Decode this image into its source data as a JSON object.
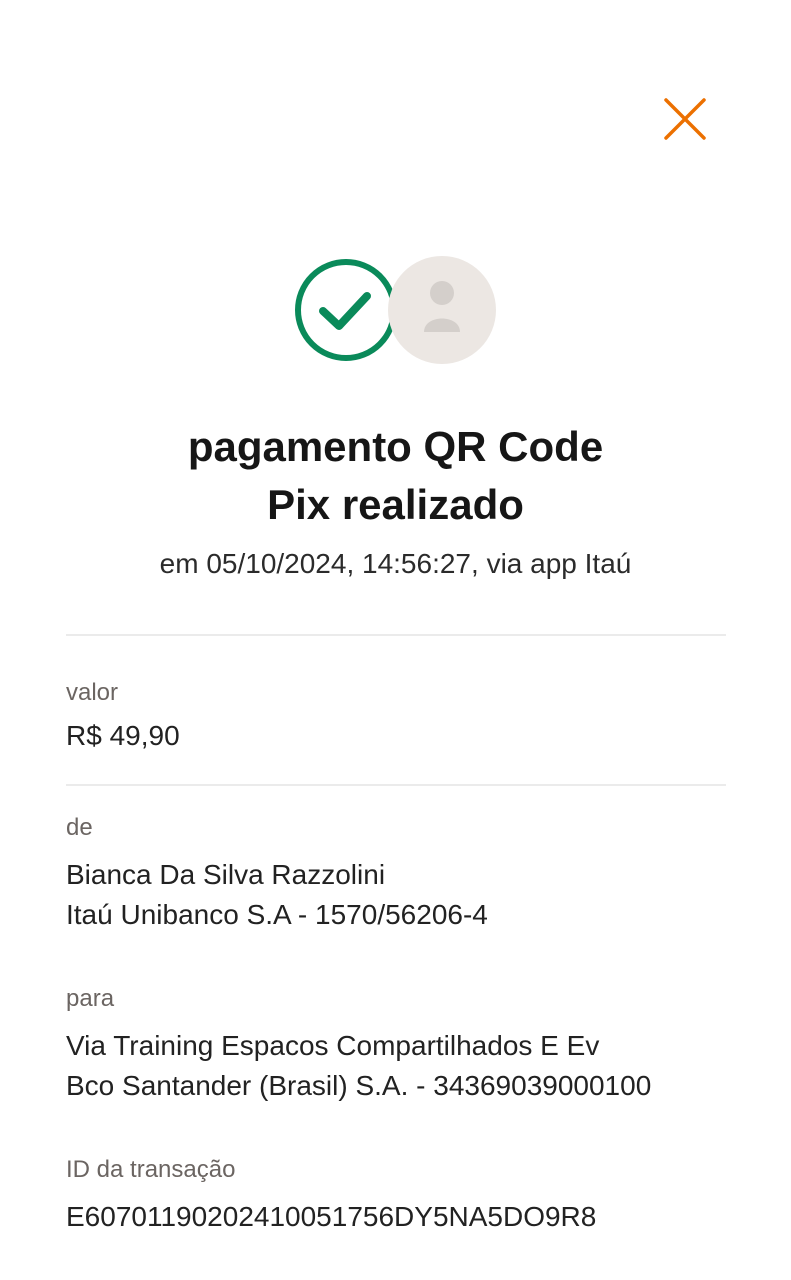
{
  "close": {
    "icon": "close-icon",
    "color": "#ec7000"
  },
  "status": {
    "check_icon": "check-circle-icon",
    "check_color": "#0a8a5a",
    "avatar_icon": "person-icon"
  },
  "title": {
    "line1": "pagamento QR Code",
    "line2": "Pix realizado"
  },
  "subtitle": "em 05/10/2024, 14:56:27, via app Itaú",
  "fields": {
    "valor": {
      "label": "valor",
      "value": "R$ 49,90"
    },
    "de": {
      "label": "de",
      "name": "Bianca Da Silva Razzolini",
      "bank": "Itaú Unibanco S.A - 1570/56206-4"
    },
    "para": {
      "label": "para",
      "name": "Via Training Espacos Compartilhados E Ev",
      "bank": "Bco Santander (Brasil) S.A. - 34369039000100"
    },
    "id": {
      "label": "ID da transação",
      "value": "E60701190202410051756DY5NA5DO9R8"
    }
  }
}
